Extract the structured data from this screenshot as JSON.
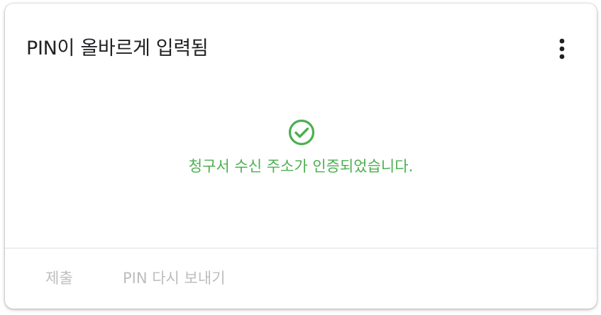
{
  "card": {
    "title": "PIN이 올바르게 입력됨",
    "more_icon": "more-vert-icon"
  },
  "status": {
    "icon": "check-circle-icon",
    "message": "청구서 수신 주소가 인증되었습니다.",
    "color": "#4caf50"
  },
  "actions": {
    "submit_label": "제출",
    "resend_label": "PIN 다시 보내기",
    "disabled_color": "#bdbdbd"
  }
}
